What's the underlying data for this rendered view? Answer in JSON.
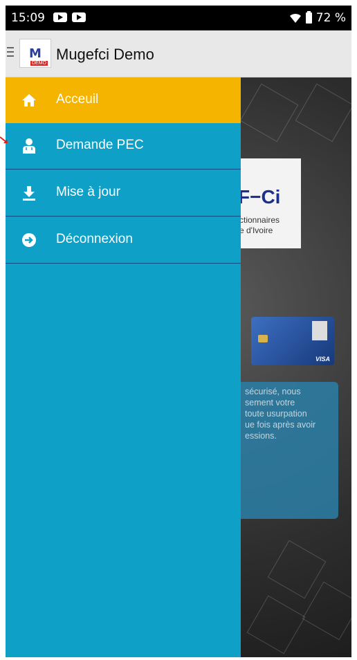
{
  "status_bar": {
    "time": "15:09",
    "battery": "72 %"
  },
  "app_bar": {
    "title": "Mugefci Demo",
    "logo_text": "M",
    "logo_badge": "DEMO"
  },
  "drawer": {
    "items": [
      {
        "label": "Acceuil",
        "icon": "home-icon",
        "active": true
      },
      {
        "label": "Demande PEC",
        "icon": "doctor-icon",
        "active": false
      },
      {
        "label": "Mise à jour",
        "icon": "download-icon",
        "active": false
      },
      {
        "label": "Déconnexion",
        "icon": "logout-icon",
        "active": false
      }
    ]
  },
  "background": {
    "logo_text": "F−Ci",
    "logo_line1": "ctionnaires",
    "logo_line2": "e d'Ivoire",
    "card_brand": "VISA",
    "info_text": [
      "sécurisé, nous",
      "sement votre",
      "toute usurpation",
      "ue fois après avoir",
      "essions."
    ]
  },
  "colors": {
    "drawer": "#0ea0c7",
    "active_item": "#f4b400",
    "divider": "#0b4d82"
  }
}
